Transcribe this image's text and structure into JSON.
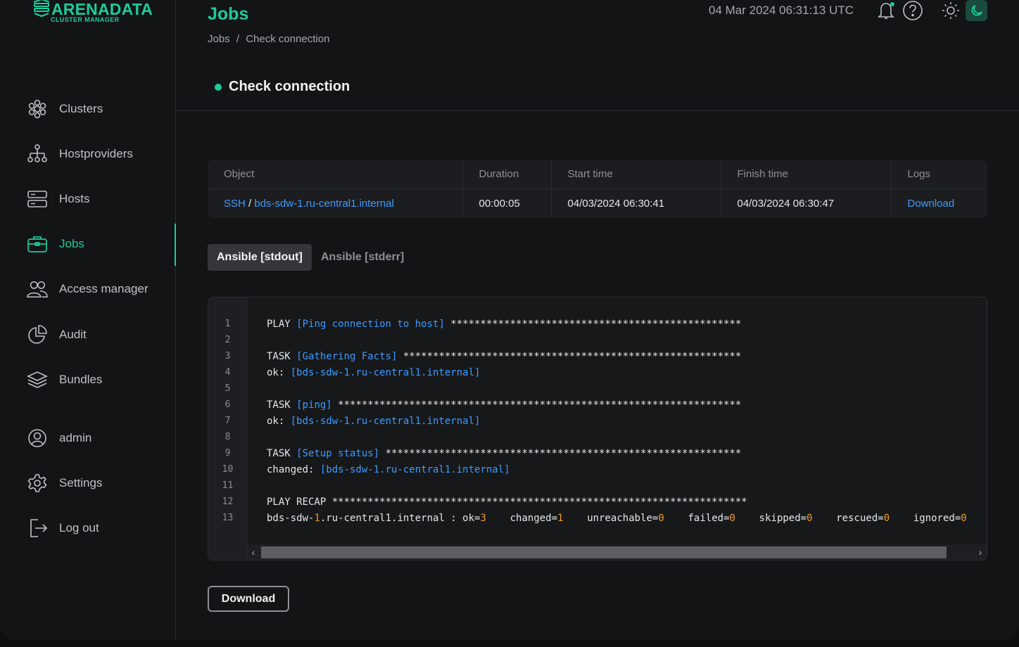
{
  "brand": {
    "name": "ARENADATA",
    "subtitle": "CLUSTER MANAGER"
  },
  "sidebar": {
    "items": [
      {
        "label": "Clusters",
        "icon": "clusters-icon"
      },
      {
        "label": "Hostproviders",
        "icon": "hierarchy-icon"
      },
      {
        "label": "Hosts",
        "icon": "server-icon"
      },
      {
        "label": "Jobs",
        "icon": "briefcase-icon",
        "active": true
      },
      {
        "label": "Access manager",
        "icon": "users-icon"
      },
      {
        "label": "Audit",
        "icon": "pie-chart-icon"
      },
      {
        "label": "Bundles",
        "icon": "layers-icon"
      },
      {
        "label": "admin",
        "icon": "user-circle-icon"
      },
      {
        "label": "Settings",
        "icon": "gear-icon"
      },
      {
        "label": "Log out",
        "icon": "logout-icon"
      }
    ]
  },
  "header": {
    "title": "Jobs",
    "breadcrumb": {
      "root": "Jobs",
      "sep": "/",
      "current": "Check connection"
    },
    "datetime": "04 Mar 2024  06:31:13  UTC"
  },
  "job": {
    "title": "Check connection",
    "status_color": "#1fcb9a"
  },
  "table": {
    "headers": [
      "Object",
      "Duration",
      "Start time",
      "Finish time",
      "Logs"
    ],
    "row": {
      "object_type": "SSH",
      "object_sep": " / ",
      "object_name": "bds-sdw-1.ru-central1.internal",
      "duration": "00:00:05",
      "start_time": "04/03/2024 06:30:41",
      "finish_time": "04/03/2024 06:30:47",
      "logs": "Download"
    }
  },
  "tabs": [
    {
      "label": "Ansible [stdout]",
      "active": true
    },
    {
      "label": "Ansible [stderr]",
      "active": false
    }
  ],
  "log": {
    "line_numbers": [
      "1",
      "2",
      "3",
      "4",
      "5",
      "6",
      "7",
      "8",
      "9",
      "10",
      "11",
      "12",
      "13"
    ],
    "lines": [
      {
        "k": "PLAY ",
        "b": "[Ping connection to host]",
        "r": " *************************************************"
      },
      {
        "k": ""
      },
      {
        "k": "TASK ",
        "b": "[Gathering Facts]",
        "r": " *********************************************************"
      },
      {
        "k": "ok: ",
        "b": "[bds-sdw-1.ru-central1.internal]"
      },
      {
        "k": ""
      },
      {
        "k": "TASK ",
        "b": "[ping]",
        "r": " ********************************************************************"
      },
      {
        "k": "ok: ",
        "b": "[bds-sdw-1.ru-central1.internal]"
      },
      {
        "k": ""
      },
      {
        "k": "TASK ",
        "b": "[Setup status]",
        "r": " ************************************************************"
      },
      {
        "k": "changed: ",
        "b": "[bds-sdw-1.ru-central1.internal]"
      },
      {
        "k": ""
      },
      {
        "k": "PLAY RECAP ",
        "r": "**********************************************************************"
      },
      {
        "recap": [
          {
            "t": "bds-sdw-"
          },
          {
            "t": "1",
            "o": true
          },
          {
            "t": ".ru-central1.internal : ok="
          },
          {
            "t": "3",
            "o": true
          },
          {
            "t": "    changed="
          },
          {
            "t": "1",
            "o": true
          },
          {
            "t": "    unreachable="
          },
          {
            "t": "0",
            "o": true
          },
          {
            "t": "    failed="
          },
          {
            "t": "0",
            "o": true
          },
          {
            "t": "    skipped="
          },
          {
            "t": "0",
            "o": true
          },
          {
            "t": "    rescued="
          },
          {
            "t": "0",
            "o": true
          },
          {
            "t": "    ignored="
          },
          {
            "t": "0",
            "o": true
          }
        ]
      }
    ]
  },
  "footer": {
    "download_label": "Download"
  },
  "colors": {
    "accent": "#1fcb9a",
    "link": "#3d9bff",
    "number": "#f09a2a"
  }
}
